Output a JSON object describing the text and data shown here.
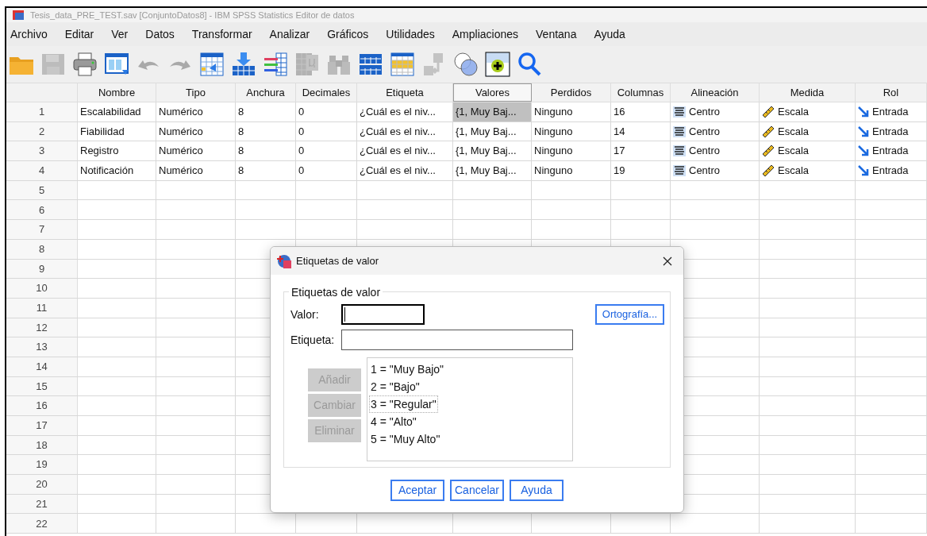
{
  "window": {
    "title": "Tesis_data_PRE_TEST.sav [ConjuntoDatos8] - IBM SPSS Statistics Editor de datos"
  },
  "menu": [
    "Archivo",
    "Editar",
    "Ver",
    "Datos",
    "Transformar",
    "Analizar",
    "Gráficos",
    "Utilidades",
    "Ampliaciones",
    "Ventana",
    "Ayuda"
  ],
  "toolbar": [
    {
      "kind": "open",
      "disabled": false
    },
    {
      "kind": "save",
      "disabled": true
    },
    {
      "kind": "print",
      "disabled": false
    },
    {
      "kind": "window",
      "disabled": false
    },
    {
      "kind": "undo",
      "disabled": true
    },
    {
      "kind": "redo",
      "disabled": true
    },
    {
      "kind": "goto",
      "disabled": false
    },
    {
      "kind": "insert",
      "disabled": false
    },
    {
      "kind": "variables",
      "disabled": false
    },
    {
      "kind": "stats",
      "disabled": true
    },
    {
      "kind": "find",
      "disabled": true
    },
    {
      "kind": "split",
      "disabled": false
    },
    {
      "kind": "select",
      "disabled": false
    },
    {
      "kind": "labels",
      "disabled": true
    },
    {
      "kind": "sets",
      "disabled": false
    },
    {
      "kind": "addon",
      "disabled": false
    },
    {
      "kind": "search",
      "disabled": false
    }
  ],
  "table": {
    "columns": [
      {
        "label": "Nombre",
        "kind": "text",
        "selected": false
      },
      {
        "label": "Tipo",
        "kind": "text",
        "selected": false
      },
      {
        "label": "Anchura",
        "kind": "text",
        "selected": false
      },
      {
        "label": "Decimales",
        "kind": "text",
        "selected": false
      },
      {
        "label": "Etiqueta",
        "kind": "text",
        "selected": false
      },
      {
        "label": "Valores",
        "kind": "text",
        "selected": true
      },
      {
        "label": "Perdidos",
        "kind": "text",
        "selected": false
      },
      {
        "label": "Columnas",
        "kind": "text",
        "selected": false
      },
      {
        "label": "Alineación",
        "kind": "align",
        "selected": false
      },
      {
        "label": "Medida",
        "kind": "measure",
        "selected": false
      },
      {
        "label": "Rol",
        "kind": "role",
        "selected": false
      }
    ],
    "rows": [
      {
        "number": "1",
        "cells": [
          {
            "text": "Escalabilidad",
            "selected": false
          },
          {
            "text": "Numérico",
            "selected": false
          },
          {
            "text": "8",
            "selected": false
          },
          {
            "text": "0",
            "selected": false
          },
          {
            "text": "¿Cuál es el niv...",
            "selected": false
          },
          {
            "text": "{1, Muy Baj...",
            "selected": true
          },
          {
            "text": "Ninguno",
            "selected": false
          },
          {
            "text": "16",
            "selected": false
          },
          {
            "text": "Centro",
            "selected": false
          },
          {
            "text": "Escala",
            "selected": false
          },
          {
            "text": "Entrada",
            "selected": false
          }
        ]
      },
      {
        "number": "2",
        "cells": [
          {
            "text": "Fiabilidad",
            "selected": false
          },
          {
            "text": "Numérico",
            "selected": false
          },
          {
            "text": "8",
            "selected": false
          },
          {
            "text": "0",
            "selected": false
          },
          {
            "text": "¿Cuál es el niv...",
            "selected": false
          },
          {
            "text": "{1, Muy Baj...",
            "selected": false
          },
          {
            "text": "Ninguno",
            "selected": false
          },
          {
            "text": "14",
            "selected": false
          },
          {
            "text": "Centro",
            "selected": false
          },
          {
            "text": "Escala",
            "selected": false
          },
          {
            "text": "Entrada",
            "selected": false
          }
        ]
      },
      {
        "number": "3",
        "cells": [
          {
            "text": "Registro",
            "selected": false
          },
          {
            "text": "Numérico",
            "selected": false
          },
          {
            "text": "8",
            "selected": false
          },
          {
            "text": "0",
            "selected": false
          },
          {
            "text": "¿Cuál es el niv...",
            "selected": false
          },
          {
            "text": "{1, Muy Baj...",
            "selected": false
          },
          {
            "text": "Ninguno",
            "selected": false
          },
          {
            "text": "17",
            "selected": false
          },
          {
            "text": "Centro",
            "selected": false
          },
          {
            "text": "Escala",
            "selected": false
          },
          {
            "text": "Entrada",
            "selected": false
          }
        ]
      },
      {
        "number": "4",
        "cells": [
          {
            "text": "Notificación",
            "selected": false
          },
          {
            "text": "Numérico",
            "selected": false
          },
          {
            "text": "8",
            "selected": false
          },
          {
            "text": "0",
            "selected": false
          },
          {
            "text": "¿Cuál es el niv...",
            "selected": false
          },
          {
            "text": "{1, Muy Baj...",
            "selected": false
          },
          {
            "text": "Ninguno",
            "selected": false
          },
          {
            "text": "19",
            "selected": false
          },
          {
            "text": "Centro",
            "selected": false
          },
          {
            "text": "Escala",
            "selected": false
          },
          {
            "text": "Entrada",
            "selected": false
          }
        ]
      },
      {
        "number": "5"
      },
      {
        "number": "6"
      },
      {
        "number": "7"
      },
      {
        "number": "8"
      },
      {
        "number": "9"
      },
      {
        "number": "10"
      },
      {
        "number": "11"
      },
      {
        "number": "12"
      },
      {
        "number": "13"
      },
      {
        "number": "14"
      },
      {
        "number": "15"
      },
      {
        "number": "16"
      },
      {
        "number": "17"
      },
      {
        "number": "18"
      },
      {
        "number": "19"
      },
      {
        "number": "20"
      },
      {
        "number": "21"
      },
      {
        "number": "22"
      }
    ]
  },
  "dialog": {
    "title": "Etiquetas de valor",
    "group_label": "Etiquetas de valor",
    "fields": [
      {
        "label": "Valor:",
        "focused": true
      },
      {
        "label": "Etiqueta:",
        "focused": false
      }
    ],
    "spelling_button": "Ortografía...",
    "side_buttons": [
      {
        "label": "Añadir",
        "disabled": true
      },
      {
        "label": "Cambiar",
        "disabled": true
      },
      {
        "label": "Eliminar",
        "disabled": true
      }
    ],
    "items": [
      {
        "text": "1 = \"Muy Bajo\"",
        "focused": false
      },
      {
        "text": "2 = \"Bajo\"",
        "focused": false
      },
      {
        "text": "3 = \"Regular\"",
        "focused": true
      },
      {
        "text": "4 = \"Alto\"",
        "focused": false
      },
      {
        "text": "5 = \"Muy Alto\"",
        "focused": false
      }
    ],
    "buttons": [
      "Aceptar",
      "Cancelar",
      "Ayuda"
    ]
  }
}
